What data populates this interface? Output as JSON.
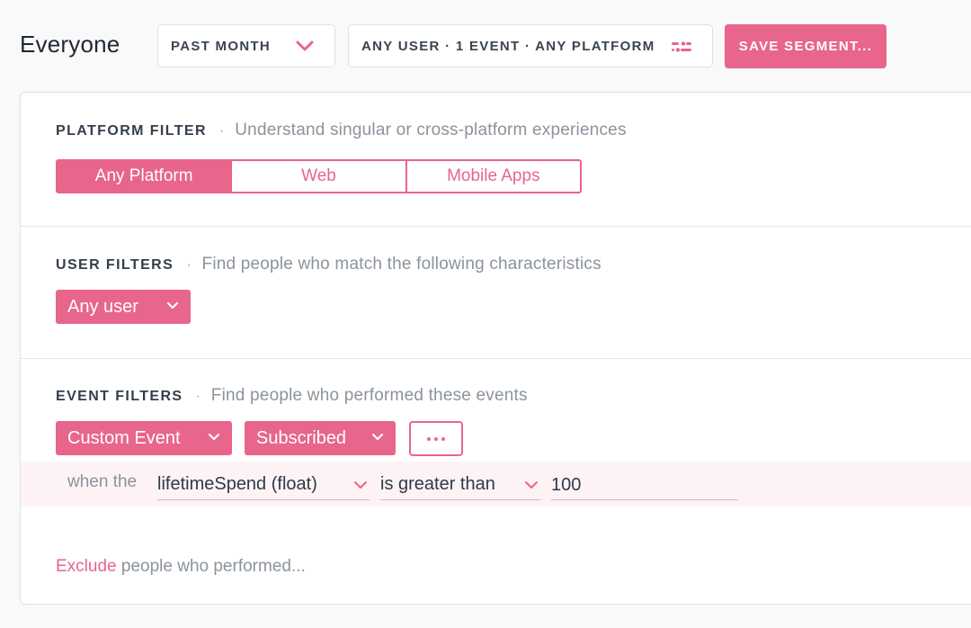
{
  "header": {
    "title": "Everyone",
    "range_label": "PAST MONTH",
    "segment_summary": "ANY USER · 1 EVENT · ANY PLATFORM",
    "save_label": "SAVE SEGMENT..."
  },
  "platform_filter": {
    "heading": "PLATFORM FILTER",
    "separator": "·",
    "description": "Understand singular or cross-platform experiences",
    "options": [
      "Any Platform",
      "Web",
      "Mobile Apps"
    ],
    "selected": "Any Platform"
  },
  "user_filters": {
    "heading": "USER FILTERS",
    "separator": "·",
    "description": "Find people who match the following characteristics",
    "dropdown_value": "Any user"
  },
  "event_filters": {
    "heading": "EVENT FILTERS",
    "separator": "·",
    "description": "Find people who performed these events",
    "event_type": "Custom Event",
    "event_name": "Subscribed",
    "condition": {
      "prefix": "when the",
      "property": "lifetimeSpend (float)",
      "operator": "is greater than",
      "value": "100"
    }
  },
  "exclude": {
    "link": "Exclude",
    "rest": " people who performed..."
  },
  "colors": {
    "accent": "#e8658b",
    "text": "#2e3a48",
    "muted": "#8b939c"
  }
}
